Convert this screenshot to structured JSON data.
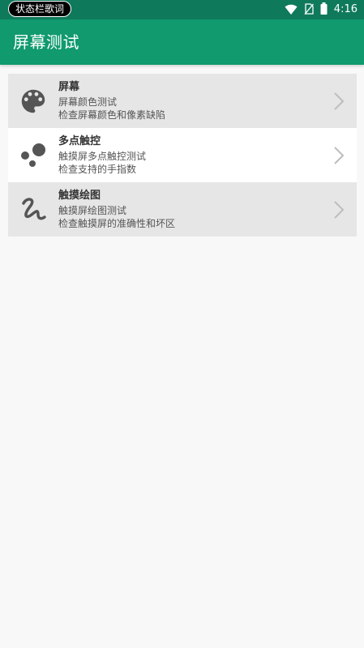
{
  "status_bar": {
    "lyric_label": "状态栏歌词",
    "time": "4:16",
    "icons": [
      "wifi-icon",
      "no-sim-icon",
      "battery-icon"
    ]
  },
  "app_bar": {
    "title": "屏幕测试"
  },
  "colors": {
    "status_bar_bg": "#0f7a5b",
    "app_bar_bg": "#109a6e",
    "page_bg": "#f8f8f8",
    "item_grey": "#e6e6e6",
    "item_white": "#ffffff",
    "icon_dark": "#555555",
    "chevron": "#bdbdbd"
  },
  "items": [
    {
      "title": "屏幕",
      "line1": "屏幕颜色测试",
      "line2": "检查屏幕颜色和像素缺陷",
      "icon": "palette-icon"
    },
    {
      "title": "多点触控",
      "line1": "触摸屏多点触控测试",
      "line2": "检查支持的手指数",
      "icon": "multitouch-dots-icon"
    },
    {
      "title": "触摸绘图",
      "line1": "触摸屏绘图测试",
      "line2": "检查触摸屏的准确性和坏区",
      "icon": "squiggle-draw-icon"
    }
  ]
}
